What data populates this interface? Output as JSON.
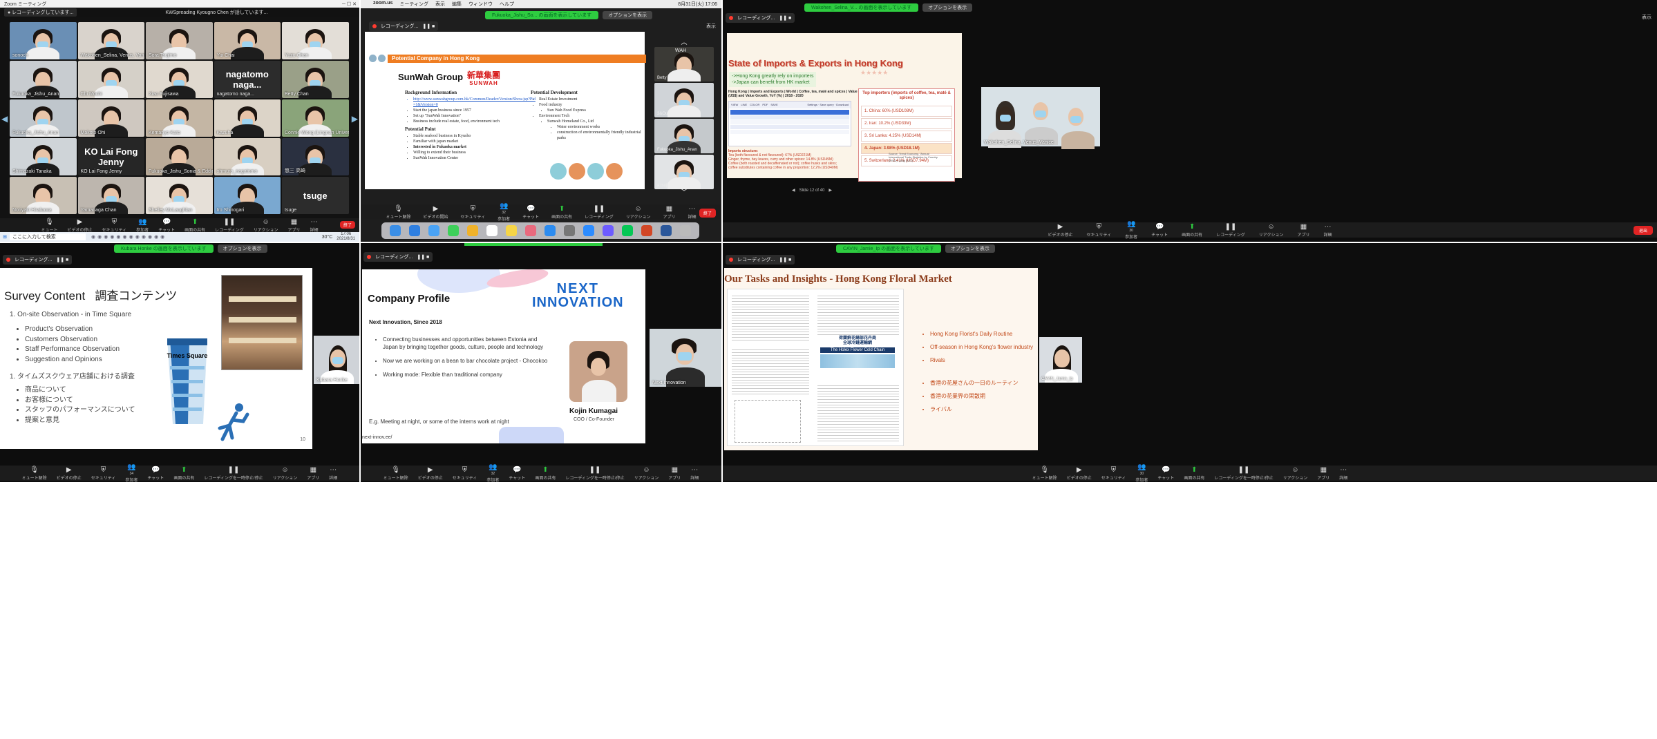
{
  "gallery": {
    "window_title": "Zoom ミーティング",
    "speaking": "KWSpreading Kyougno Chen が話しています...",
    "tiles": [
      {
        "name": "sonoch"
      },
      {
        "name": "Wakohen_Selina, Venus, Vanice"
      },
      {
        "name": "Sora Tsujimo"
      },
      {
        "name": "Yui Chai"
      },
      {
        "name": "Yuzu Chan"
      },
      {
        "name": "Fukuoka_Jishu_Anan"
      },
      {
        "name": "Chi Mochi"
      },
      {
        "name": "Xiao Fujisawa"
      },
      {
        "name": "nagatomo naga...",
        "label": "nagatomo  naga..."
      },
      {
        "name": "Betty Chan"
      },
      {
        "name": "Fukuoka_Jishu_Anan"
      },
      {
        "name": "Makoto Ohi"
      },
      {
        "name": "Kemanyo Kato"
      },
      {
        "name": "Kazuha"
      },
      {
        "name": "Connie Wong (Lingnan University)"
      },
      {
        "name": "Shimazaki Tanaka"
      },
      {
        "name": "KO Lai Fong Jenny",
        "label": "KO Lai Fong Jenny"
      },
      {
        "name": "Fukuoka_Jishu_Sonia & Eddie"
      },
      {
        "name": "ohmuro_nagatomo"
      },
      {
        "name": "悠三 高崎"
      },
      {
        "name": "Noriyaki Hirakawa"
      },
      {
        "name": "Yamanaga Chan"
      },
      {
        "name": "Shelley McLaughlan"
      },
      {
        "name": "Iro Shinogari"
      },
      {
        "name": "tsuge",
        "label": "tsuge"
      }
    ],
    "toolbar": [
      "ミュート",
      "ビデオの停止",
      "セキュリティ",
      "参加者",
      "チャット",
      "画面の共有",
      "レコーディング",
      "リアクション",
      "アプリ",
      "詳細"
    ],
    "taskbar": {
      "search_placeholder": "ここに入力して検索",
      "clock": "17:06",
      "date": "2021/8/31",
      "weather": "30°C"
    },
    "end_label": "終了"
  },
  "mac": {
    "menubar": [
      "zoom.us",
      "ミーティング",
      "表示",
      "編集",
      "ウィンドウ",
      "ヘルプ"
    ],
    "datetime": "8月31日(火) 17:06",
    "share_banner": "Fukuoka_Jishu_So... の画面を表示しています",
    "share_options": "オプションを表示",
    "recording": "レコーディング...",
    "view_label": "表示",
    "slide": {
      "header": "Potential Company in Hong Kong",
      "company": "SunWah Group",
      "logo_cn": "新華集團",
      "logo_en": "SUNWAH",
      "bg_title": "Background Information",
      "bg_items": [
        "http://www.sunwahgroup.com.hk/Common/Reader/Version/Show.jsp?Pid=1&Version=0",
        "Start the japan business since 1957",
        "Set up \"SunWah Innovation\"",
        "Business include real estate, food, environment tech"
      ],
      "pp_title": "Potential Point",
      "pp_items": [
        "Stable seafood business in Kyusho",
        "Familiar with japan market",
        "Interested in Fukuoka market",
        "Willing to extend their business",
        "SunWah Innovation Center"
      ],
      "pd_title": "Potential Development",
      "pd_items": [
        "Real Estate Investment",
        "Food industry",
        "Environment Tech"
      ],
      "pd_food_sub": "Sun Wah Food Express",
      "pd_env_sub": "Sunwah Homeland Co., Ltd",
      "pd_env_sub2": [
        "Water environment works",
        "construction of environmentally friendly industrial parks"
      ]
    },
    "side_tiles": [
      {
        "name": "Betty Chan"
      },
      {
        "name": "3&Ouke_ar ta"
      },
      {
        "name": "Fukuoka_Jishu_Anan"
      },
      {
        "name": "a.tsuji"
      }
    ],
    "wah_text": "WAH",
    "toolbar": [
      "ミュート解除",
      "ビデオの開始",
      "セキュリティ",
      "参加者",
      "チャット",
      "画面の共有",
      "レコーディング",
      "リアクション",
      "アプリ",
      "詳細"
    ],
    "participants": "32",
    "end_label": "終了"
  },
  "imports": {
    "share_banner": "Wakohen_Selina_V... の画面を表示しています",
    "share_options": "オプションを表示",
    "recording": "レコーディング...",
    "view_label": "表示",
    "slide": {
      "title": "State of Imports & Exports in Hong Kong",
      "bullets": [
        "->Hong Kong greatly rely on importers",
        "->Japan can benefit from HK market"
      ],
      "table_title": "Hong Kong | Imports and Exports | World | Coffee, tea, maté and spices | Value (US$) and Value Growth, YoY (%) | 2018 - 2020",
      "box_title": "Top importers (imports of coffee, tea, maté & spices)",
      "importers": [
        "1. China: 60% (USD108M)",
        "2. Iran: 10.2% (USD33M)",
        "3. Sri Lanka: 4.25% (USD14M)",
        "4. Japan: 3.98% (USD18.1M)",
        "5. Switzerland: 2.41% (USD7.94M)"
      ],
      "structure_title": "Imports structure:",
      "structure": [
        "Tea (both flavoured & not flavoured): 67% (USD221M)",
        "Ginger, thyme, bay leaves, curry and other spices: 14.8% (USD49M)",
        "Coffee (both roasted and decaffeinated or not); coffee husks and skins;",
        "coffee substitutes containing coffee in any proportion: 12.2% (USD40M)"
      ],
      "source": "Source: Trend Economy, \"Annual International Trade Statistics by Country (HS02)\" (Aug 2021)",
      "page": "Slide 12 of 40"
    },
    "video_name": "Wakohen_Selina_Venus_Vanice",
    "toolbar": [
      "ビデオの停止",
      "セキュリティ",
      "参加者",
      "チャット",
      "画面の共有",
      "レコーディング",
      "リアクション",
      "アプリ",
      "詳細"
    ],
    "participants": "30",
    "end_label": "退出"
  },
  "survey": {
    "share_banner": "Kubara Honke の画面を表示しています",
    "share_options": "オプションを表示",
    "recording": "レコーディング...",
    "slide": {
      "title": "Survey Content   調査コンテンツ",
      "s1": "1.  On-site Observation - in Time Square",
      "s1_items": [
        "Product's Observation",
        "Customers Observation",
        "Staff Performance Observation",
        "Suggestion and Opinions"
      ],
      "s2": "1.  タイムズスクウェア店舗における調査",
      "s2_items": [
        "商品について",
        "お客様について",
        "スタッフのパフォーマンスについて",
        "提案と意見"
      ],
      "tower_label": "Times Square",
      "page": "10"
    },
    "video_name": "Kubara Honke",
    "toolbar": [
      "ミュート解除",
      "ビデオの停止",
      "セキュリティ",
      "参加者",
      "チャット",
      "画面の共有",
      "レコーディングを一時停止/停止",
      "リアクション",
      "アプリ",
      "詳細"
    ],
    "participants": "34"
  },
  "profile": {
    "recording": "レコーディング...",
    "slide": {
      "title": "Company Profile",
      "logo_line1": "NEXT",
      "logo_line2": "INNOVATION",
      "since": "Next Innovation, Since 2018",
      "bullets": [
        "Connecting businesses and opportunities between Estonia and Japan by bringing together goods, culture, people and technology",
        "Now we are working on a bean to bar chocolate project - Chocokoo",
        "Working mode: Flexible than traditional company"
      ],
      "example": "E.g. Meeting at night, or some of the interns work at night",
      "person": "Kojin Kumagai",
      "role": "COO / Co-Founder",
      "url": "next-innov.ee/"
    },
    "video_name": "Next Innovation",
    "toolbar": [
      "ミュート解除",
      "ビデオの停止",
      "セキュリティ",
      "参加者",
      "チャット",
      "画面の共有",
      "レコーディングを一時停止/停止",
      "リアクション",
      "アプリ",
      "詳細"
    ],
    "participants": "32"
  },
  "floral": {
    "share_banner": "CAVIN_Jamie_Ip の画面を表示しています",
    "share_options": "オプションを表示",
    "recording": "レコーディング...",
    "slide": {
      "title": "Our Tasks and Insights - Hong Kong Floral Market",
      "chain_cn": "荷蘭鮮花總部花卉商\n全球冷鏈運輸網",
      "chain_en": "The Holex Flower Cold Chain",
      "items_en": [
        "Hong Kong Florist's Daily Routine",
        "Off-season in Hong Kong's flower industry",
        "Rivals"
      ],
      "items_jp": [
        "香港の花屋さんの一日のルーティン",
        "香港の花業界の閑散期",
        "ライバル"
      ]
    },
    "video_name": "CAVIN_Jamie_Ip",
    "toolbar": [
      "ミュート解除",
      "ビデオの停止",
      "セキュリティ",
      "参加者",
      "チャット",
      "画面の共有",
      "レコーディングを一時停止/停止",
      "リアクション",
      "アプリ",
      "詳細"
    ],
    "participants": "30"
  },
  "colors": {
    "zoom_green": "#2ecc40",
    "end_red": "#e02424",
    "orange": "#ef7d22",
    "floral_brown": "#8b3b1a",
    "next_blue": "#1a66c8"
  }
}
